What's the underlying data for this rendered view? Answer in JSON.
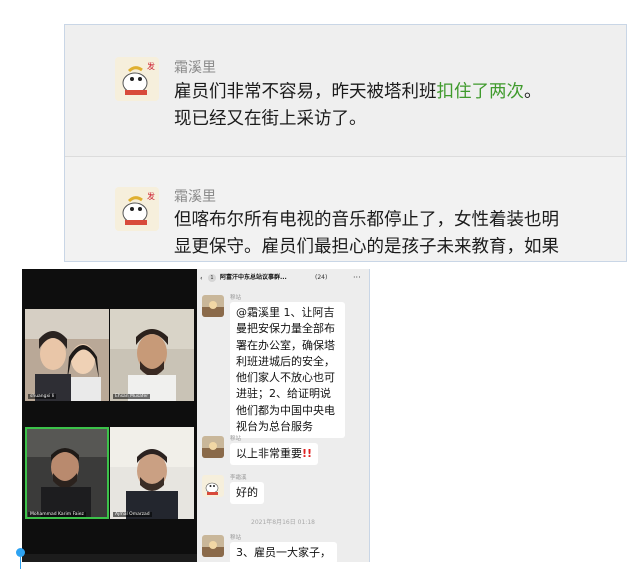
{
  "top_chat": {
    "messages": [
      {
        "sender": "霜溪里",
        "line1_plain": "雇员们非常不容易，昨天被塔利班",
        "line1_green": "扣住了两次",
        "line1_end": "。",
        "line2": "现已经又在街上采访了。"
      },
      {
        "sender": "霜溪里",
        "line1": "但喀布尔所有电视的音乐都停止了，女性着装也明",
        "line2": "显更保守。雇员们最担心的是孩子未来教育，如果"
      }
    ]
  },
  "video_call": {
    "participants": [
      {
        "name": "shuangxi li"
      },
      {
        "name": "Ehsan Musafer"
      },
      {
        "name": "Mohammad Karim Faiez"
      },
      {
        "name": "Ajmal Omarzad"
      }
    ],
    "active_speaker": "Mohammad Karim Faiez",
    "page_dots": 3,
    "current_page": 2
  },
  "group_chat": {
    "header": {
      "back": "‹",
      "unread": "1",
      "title": "阿富汗中东总站议事群...",
      "count": "(24)",
      "more": "···"
    },
    "messages": [
      {
        "sender": "穆站",
        "lines": [
          "@霜溪里 1、让阿吉",
          "曼把安保力量全部布",
          "署在办公室，确保塔",
          "利班进城后的安全，",
          "他们家人不放心也可",
          "进驻；2、给证明说",
          "他们都为中国中央电",
          "视台为总台服务"
        ]
      },
      {
        "sender": "穆站",
        "text": "以上非常重要",
        "emphasis": "!!"
      },
      {
        "sender": "李霜溪",
        "text": "好的"
      },
      {
        "sender": "穆站",
        "text": "3、雇员一大家子，"
      }
    ],
    "timestamp": "2021年8月16日 01:18"
  }
}
